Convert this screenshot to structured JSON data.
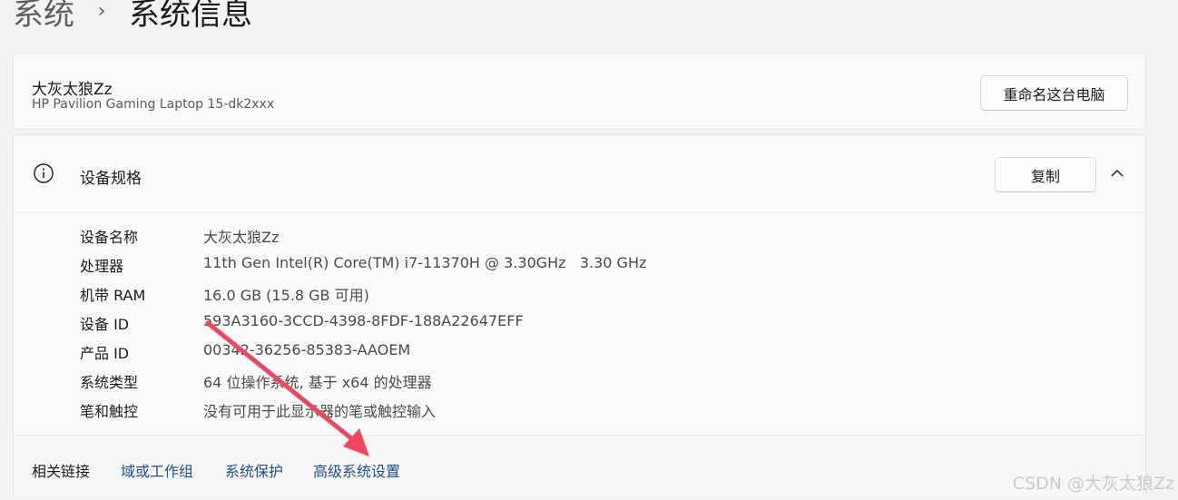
{
  "breadcrumb": {
    "parent": "系统",
    "separator_icon": "chevron-right-icon",
    "current": "系统信息"
  },
  "device": {
    "name": "大灰太狼Zz",
    "model": "HP Pavilion Gaming Laptop 15-dk2xxx",
    "rename_label": "重命名这台电脑"
  },
  "specs": {
    "icon": "info-icon",
    "title": "设备规格",
    "copy_label": "复制",
    "collapse_icon": "chevron-up-icon",
    "rows": [
      {
        "label": "设备名称",
        "value": "大灰太狼Zz"
      },
      {
        "label": "处理器",
        "value": "11th Gen Intel(R) Core(TM) i7-11370H @ 3.30GHz   3.30 GHz"
      },
      {
        "label": "机带 RAM",
        "value": "16.0 GB (15.8 GB 可用)"
      },
      {
        "label": "设备 ID",
        "value": "593A3160-3CCD-4398-8FDF-188A22647EFF"
      },
      {
        "label": "产品 ID",
        "value": "00342-36256-85383-AAOEM"
      },
      {
        "label": "系统类型",
        "value": "64 位操作系统, 基于 x64 的处理器"
      },
      {
        "label": "笔和触控",
        "value": "没有可用于此显示器的笔或触控输入"
      }
    ]
  },
  "related": {
    "label": "相关链接",
    "links": [
      "域或工作组",
      "系统保护",
      "高级系统设置"
    ]
  },
  "annotation": {
    "arrow_color": "#f0455f"
  },
  "watermark": "CSDN @大灰太狼Zz"
}
